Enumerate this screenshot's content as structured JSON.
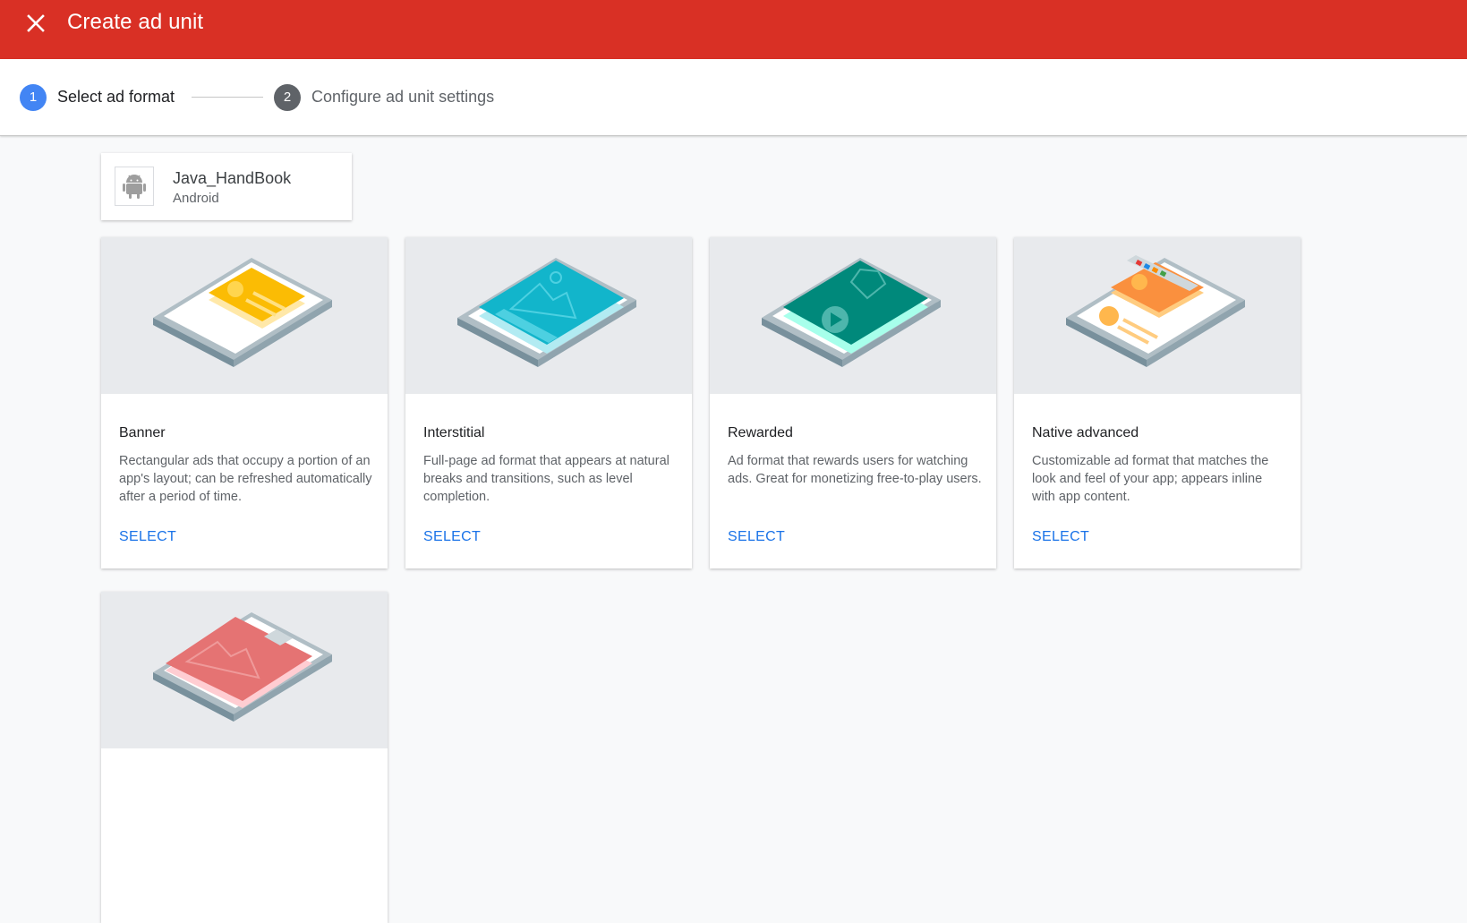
{
  "header": {
    "title": "Create ad unit",
    "close_icon": "close-icon",
    "background_color": "#d93025"
  },
  "stepper": {
    "steps": [
      {
        "number": "1",
        "label": "Select ad format",
        "state": "active"
      },
      {
        "number": "2",
        "label": "Configure ad unit settings",
        "state": "inactive"
      }
    ],
    "active_color": "#4285f4",
    "inactive_color": "#5f6368"
  },
  "app": {
    "name": "Java_HandBook",
    "platform": "Android",
    "icon": "android-icon"
  },
  "formats": [
    {
      "title": "Banner",
      "description": "Rectangular ads that occupy a portion of an app's layout; can be refreshed automatically after a period of time.",
      "action": "SELECT",
      "icon": "banner-illustration",
      "accent_color": "#fbbc04"
    },
    {
      "title": "Interstitial",
      "description": "Full-page ad format that appears at natural breaks and transitions, such as level completion.",
      "action": "SELECT",
      "icon": "interstitial-illustration",
      "accent_color": "#12b5cb"
    },
    {
      "title": "Rewarded",
      "description": "Ad format that rewards users for watching ads. Great for monetizing free-to-play users.",
      "action": "SELECT",
      "icon": "rewarded-illustration",
      "accent_color": "#00897b"
    },
    {
      "title": "Native advanced",
      "description": "Customizable ad format that matches the look and feel of your app; appears inline with app content.",
      "action": "SELECT",
      "icon": "native-advanced-illustration",
      "accent_color": "#fa903e"
    },
    {
      "title": "",
      "description": "",
      "action": "",
      "icon": "rewarded-interstitial-illustration",
      "accent_color": "#e57373"
    }
  ],
  "link_color": "#1a73e8"
}
